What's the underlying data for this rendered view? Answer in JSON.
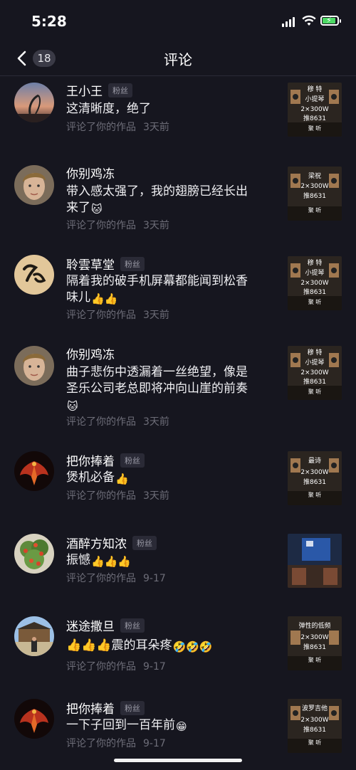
{
  "status": {
    "time": "5:28"
  },
  "header": {
    "title": "评论",
    "count": "18"
  },
  "colors": {
    "background": "#16161f",
    "muted": "#6d6d78",
    "badge": "#2a2a36",
    "battery": "#4cd964"
  },
  "comments": [
    {
      "name": "王小王",
      "badge": "粉丝",
      "text": "这清晰度，绝了",
      "emojis": "",
      "meta": "评论了你的作品",
      "time": "3天前",
      "thumb_lines": [
        "穆  特",
        "小提琴",
        "2×300W",
        "推8631",
        "聚 听"
      ]
    },
    {
      "name": "你别鸡冻",
      "badge": "",
      "text": "带入感太强了，我的翅膀已经长出来了",
      "emojis": "🐱",
      "meta": "评论了你的作品",
      "time": "3天前",
      "thumb_lines": [
        "梁祝",
        "2×300W",
        "推8631",
        "聚 听"
      ]
    },
    {
      "name": "聆雲草堂",
      "badge": "粉丝",
      "text": "隔着我的破手机屏幕都能闻到松香味儿",
      "emojis": "👍👍",
      "meta": "评论了你的作品",
      "time": "3天前",
      "thumb_lines": [
        "穆  特",
        "小提琴",
        "2×300W",
        "推8631",
        "聚 听"
      ]
    },
    {
      "name": "你别鸡冻",
      "badge": "",
      "text": "曲子悲伤中透漏着一丝绝望，像是圣乐公司老总即将冲向山崖的前奏",
      "emojis": "🐱",
      "meta": "评论了你的作品",
      "time": "3天前",
      "thumb_lines": [
        "穆  特",
        "小提琴",
        "2×300W",
        "推8631",
        "聚 听"
      ]
    },
    {
      "name": "把你捧着",
      "badge": "粉丝",
      "text": "煲机必备",
      "emojis": "👍",
      "meta": "评论了你的作品",
      "time": "3天前",
      "thumb_lines": [
        "最诗",
        "2×300W",
        "推8631",
        "聚 听"
      ]
    },
    {
      "name": "酒醉方知浓",
      "badge": "粉丝",
      "text": "振憾",
      "emojis": "👍👍👍",
      "meta": "评论了你的作品",
      "time": "9-17",
      "thumb_lines": []
    },
    {
      "name": "迷途撒旦",
      "badge": "粉丝",
      "text": "👍👍👍震的耳朵疼",
      "emojis": "🤣🤣🤣",
      "meta": "评论了你的作品",
      "time": "9-17",
      "thumb_lines": [
        "弹性的低频",
        "2×300W",
        "推8631",
        "聚 听"
      ]
    },
    {
      "name": "把你捧着",
      "badge": "粉丝",
      "text": "一下子回到一百年前",
      "emojis": "😁",
      "meta": "评论了你的作品",
      "time": "9-17",
      "thumb_lines": [
        "波罗吉他",
        "2×300W",
        "推8631",
        "聚 听"
      ]
    }
  ]
}
